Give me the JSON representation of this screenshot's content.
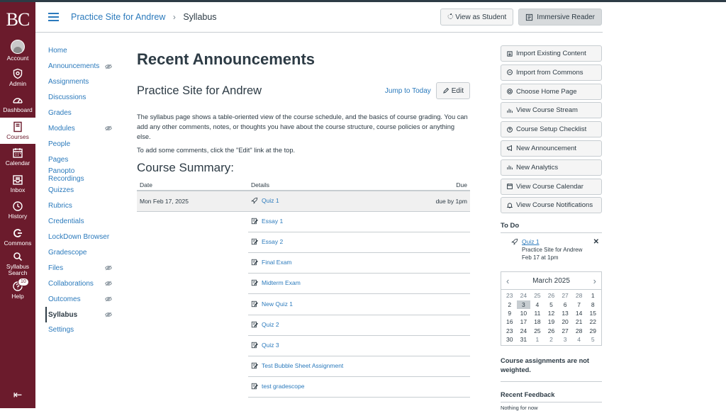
{
  "global_nav": {
    "logo": "BC",
    "items": [
      {
        "label": "Account",
        "icon": "avatar"
      },
      {
        "label": "Admin",
        "icon": "shield-icon"
      },
      {
        "label": "Dashboard",
        "icon": "dashboard-icon"
      },
      {
        "label": "Courses",
        "icon": "book-icon"
      },
      {
        "label": "Calendar",
        "icon": "calendar-icon"
      },
      {
        "label": "Inbox",
        "icon": "inbox-icon"
      },
      {
        "label": "History",
        "icon": "clock-icon"
      },
      {
        "label": "Commons",
        "icon": "commons-icon"
      },
      {
        "label": "Syllabus Search",
        "icon": "search-icon"
      },
      {
        "label": "Help",
        "icon": "help-icon",
        "badge": "10"
      }
    ],
    "active": "Courses",
    "collapse_icon": "collapse-left-icon"
  },
  "header": {
    "breadcrumb_course": "Practice Site for Andrew",
    "breadcrumb_separator": "›",
    "breadcrumb_page": "Syllabus",
    "view_as_student": "View as Student",
    "immersive_reader": "Immersive Reader"
  },
  "course_nav": {
    "items": [
      {
        "label": "Home",
        "hidden": false
      },
      {
        "label": "Announcements",
        "hidden": true
      },
      {
        "label": "Assignments",
        "hidden": false
      },
      {
        "label": "Discussions",
        "hidden": false
      },
      {
        "label": "Grades",
        "hidden": false
      },
      {
        "label": "Modules",
        "hidden": true
      },
      {
        "label": "People",
        "hidden": false
      },
      {
        "label": "Pages",
        "hidden": false
      },
      {
        "label": "Panopto Recordings",
        "hidden": false
      },
      {
        "label": "Quizzes",
        "hidden": false
      },
      {
        "label": "Rubrics",
        "hidden": false
      },
      {
        "label": "Credentials",
        "hidden": false
      },
      {
        "label": "LockDown Browser",
        "hidden": false
      },
      {
        "label": "Gradescope",
        "hidden": false
      },
      {
        "label": "Files",
        "hidden": true
      },
      {
        "label": "Collaborations",
        "hidden": true
      },
      {
        "label": "Outcomes",
        "hidden": true
      },
      {
        "label": "Syllabus",
        "hidden": true,
        "active": true
      },
      {
        "label": "Settings",
        "hidden": false
      }
    ]
  },
  "main": {
    "title": "Recent Announcements",
    "course_title": "Practice Site for Andrew",
    "jump_to_today": "Jump to Today",
    "edit": "Edit",
    "description": "The syllabus page shows a table-oriented view of the course schedule, and the basics of course grading. You can add any other comments, notes, or thoughts you have about the course structure, course policies or anything else.",
    "description2": "To add some comments, click the \"Edit\" link at the top.",
    "summary_title": "Course Summary:",
    "columns": {
      "date": "Date",
      "details": "Details",
      "due": "Due"
    },
    "rows": [
      {
        "date": "Mon Feb 17, 2025",
        "name": "Quiz 1",
        "type": "quiz",
        "due": "due by 1pm"
      },
      {
        "date": "",
        "name": "Essay 1",
        "type": "assignment",
        "due": ""
      },
      {
        "date": "",
        "name": "Essay 2",
        "type": "assignment",
        "due": ""
      },
      {
        "date": "",
        "name": "Final Exam",
        "type": "assignment",
        "due": ""
      },
      {
        "date": "",
        "name": "Midterm Exam",
        "type": "assignment",
        "due": ""
      },
      {
        "date": "",
        "name": "New Quiz 1",
        "type": "assignment",
        "due": ""
      },
      {
        "date": "",
        "name": "Quiz 2",
        "type": "assignment",
        "due": ""
      },
      {
        "date": "",
        "name": "Quiz 3",
        "type": "assignment",
        "due": ""
      },
      {
        "date": "",
        "name": "Test Bubble Sheet Assignment",
        "type": "assignment",
        "due": ""
      },
      {
        "date": "",
        "name": "test gradescope",
        "type": "assignment",
        "due": ""
      }
    ]
  },
  "sidebar": {
    "buttons": [
      {
        "label": "Import Existing Content",
        "icon": "import-icon"
      },
      {
        "label": "Import from Commons",
        "icon": "commons-icon"
      },
      {
        "label": "Choose Home Page",
        "icon": "target-icon"
      },
      {
        "label": "View Course Stream",
        "icon": "bar-chart-icon"
      },
      {
        "label": "Course Setup Checklist",
        "icon": "question-icon"
      },
      {
        "label": "New Announcement",
        "icon": "megaphone-icon"
      },
      {
        "label": "New Analytics",
        "icon": "bar-chart-icon"
      },
      {
        "label": "View Course Calendar",
        "icon": "calendar-icon"
      },
      {
        "label": "View Course Notifications",
        "icon": "bell-icon"
      }
    ],
    "todo_heading": "To Do",
    "todo": {
      "name": "Quiz 1",
      "course": "Practice Site for Andrew",
      "due": "Feb 17 at 1pm",
      "close": "✕"
    },
    "calendar": {
      "month": "March 2025",
      "prev": "‹",
      "next": "›",
      "days": [
        {
          "d": "23",
          "other": true
        },
        {
          "d": "24",
          "other": true
        },
        {
          "d": "25",
          "other": true
        },
        {
          "d": "26",
          "other": true
        },
        {
          "d": "27",
          "other": true
        },
        {
          "d": "28",
          "other": true
        },
        {
          "d": "1",
          "other": false
        },
        {
          "d": "2",
          "other": false
        },
        {
          "d": "3",
          "other": false,
          "today": true
        },
        {
          "d": "4",
          "other": false
        },
        {
          "d": "5",
          "other": false
        },
        {
          "d": "6",
          "other": false
        },
        {
          "d": "7",
          "other": false
        },
        {
          "d": "8",
          "other": false
        },
        {
          "d": "9",
          "other": false
        },
        {
          "d": "10",
          "other": false
        },
        {
          "d": "11",
          "other": false
        },
        {
          "d": "12",
          "other": false
        },
        {
          "d": "13",
          "other": false
        },
        {
          "d": "14",
          "other": false
        },
        {
          "d": "15",
          "other": false
        },
        {
          "d": "16",
          "other": false
        },
        {
          "d": "17",
          "other": false
        },
        {
          "d": "18",
          "other": false
        },
        {
          "d": "19",
          "other": false
        },
        {
          "d": "20",
          "other": false
        },
        {
          "d": "21",
          "other": false
        },
        {
          "d": "22",
          "other": false
        },
        {
          "d": "23",
          "other": false
        },
        {
          "d": "24",
          "other": false
        },
        {
          "d": "25",
          "other": false
        },
        {
          "d": "26",
          "other": false
        },
        {
          "d": "27",
          "other": false
        },
        {
          "d": "28",
          "other": false
        },
        {
          "d": "29",
          "other": false
        },
        {
          "d": "30",
          "other": false
        },
        {
          "d": "31",
          "other": false
        },
        {
          "d": "1",
          "other": true
        },
        {
          "d": "2",
          "other": true
        },
        {
          "d": "3",
          "other": true
        },
        {
          "d": "4",
          "other": true
        },
        {
          "d": "5",
          "other": true
        }
      ]
    },
    "weight_note": "Course assignments are not weighted.",
    "feedback_heading": "Recent Feedback",
    "feedback_text": "Nothing for now"
  },
  "colors": {
    "brand": "#6b1b2c",
    "link": "#2b7abc",
    "text": "#2d3b45",
    "border": "#c7cdd1"
  }
}
